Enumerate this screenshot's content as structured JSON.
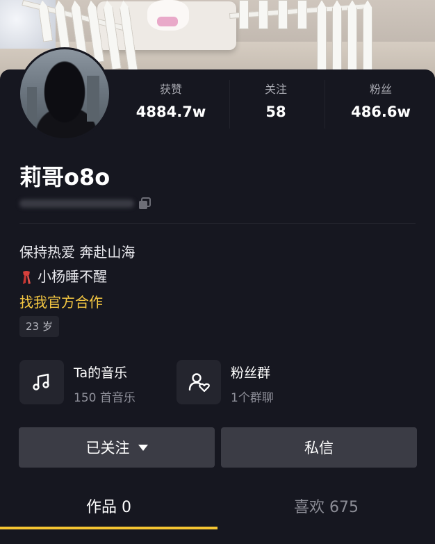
{
  "profile": {
    "name": "莉哥o8o",
    "stats": [
      {
        "label": "获赞",
        "value": "4884.7w"
      },
      {
        "label": "关注",
        "value": "58"
      },
      {
        "label": "粉丝",
        "value": "486.6w"
      }
    ],
    "bio_line1": "保持热爱 奔赴山海",
    "bio_line2": "小杨睡不醒",
    "bio_line3": "找我官方合作",
    "age_tag": "23 岁"
  },
  "tiles": {
    "music_title": "Ta的音乐",
    "music_sub": "150 首音乐",
    "fans_title": "粉丝群",
    "fans_sub": "1个群聊"
  },
  "actions": {
    "follow_label": "已关注",
    "message_label": "私信"
  },
  "tabs": [
    {
      "label": "作品 0",
      "active": true
    },
    {
      "label": "喜欢 675",
      "active": false
    }
  ],
  "colors": {
    "background": "#161720",
    "accent": "#f5c532",
    "link": "#f7c942"
  }
}
